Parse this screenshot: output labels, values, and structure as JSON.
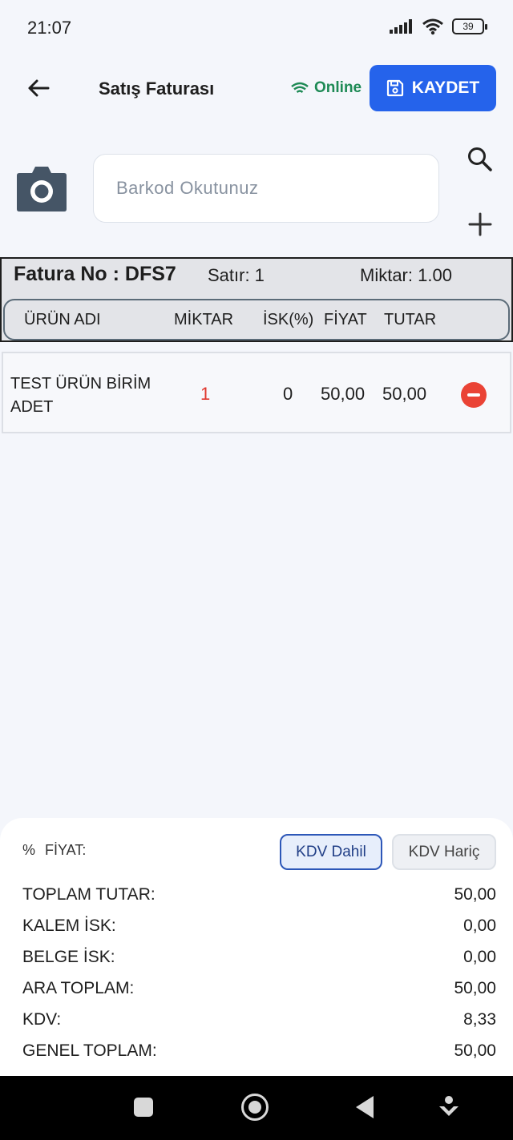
{
  "status_bar": {
    "time": "21:07",
    "battery": "39"
  },
  "app_bar": {
    "title": "Satış Faturası",
    "online_label": "Online",
    "save_label": "KAYDET"
  },
  "barcode": {
    "placeholder": "Barkod Okutunuz"
  },
  "invoice": {
    "number_label": "Fatura No : DFS7",
    "rows_label": "Satır: 1",
    "quantity_label": "Miktar: 1.00"
  },
  "columns": {
    "product": "ÜRÜN ADI",
    "quantity": "MİKTAR",
    "discount": "İSK(%)",
    "price": "FİYAT",
    "total": "TUTAR"
  },
  "items": [
    {
      "name": "TEST ÜRÜN BİRİM ADET",
      "quantity": "1",
      "discount": "0",
      "price": "50,00",
      "total": "50,00"
    }
  ],
  "summary": {
    "price_label": "FİYAT:",
    "percent_symbol": "%",
    "kdv_included": "KDV Dahil",
    "kdv_excluded": "KDV Hariç",
    "rows": [
      {
        "label": "TOPLAM TUTAR:",
        "value": "50,00"
      },
      {
        "label": "KALEM İSK:",
        "value": "0,00"
      },
      {
        "label": "BELGE İSK:",
        "value": "0,00"
      },
      {
        "label": "ARA TOPLAM:",
        "value": "50,00"
      },
      {
        "label": "KDV:",
        "value": "8,33"
      },
      {
        "label": "GENEL TOPLAM:",
        "value": "50,00"
      }
    ]
  },
  "colors": {
    "accent": "#2563eb",
    "online": "#1e8a55",
    "remove": "#ea4335",
    "quantity": "#e0382e"
  },
  "icons": [
    "back-arrow-icon",
    "wifi-icon",
    "save-icon",
    "camera-icon",
    "search-icon",
    "plus-icon",
    "minus-circle-icon"
  ]
}
